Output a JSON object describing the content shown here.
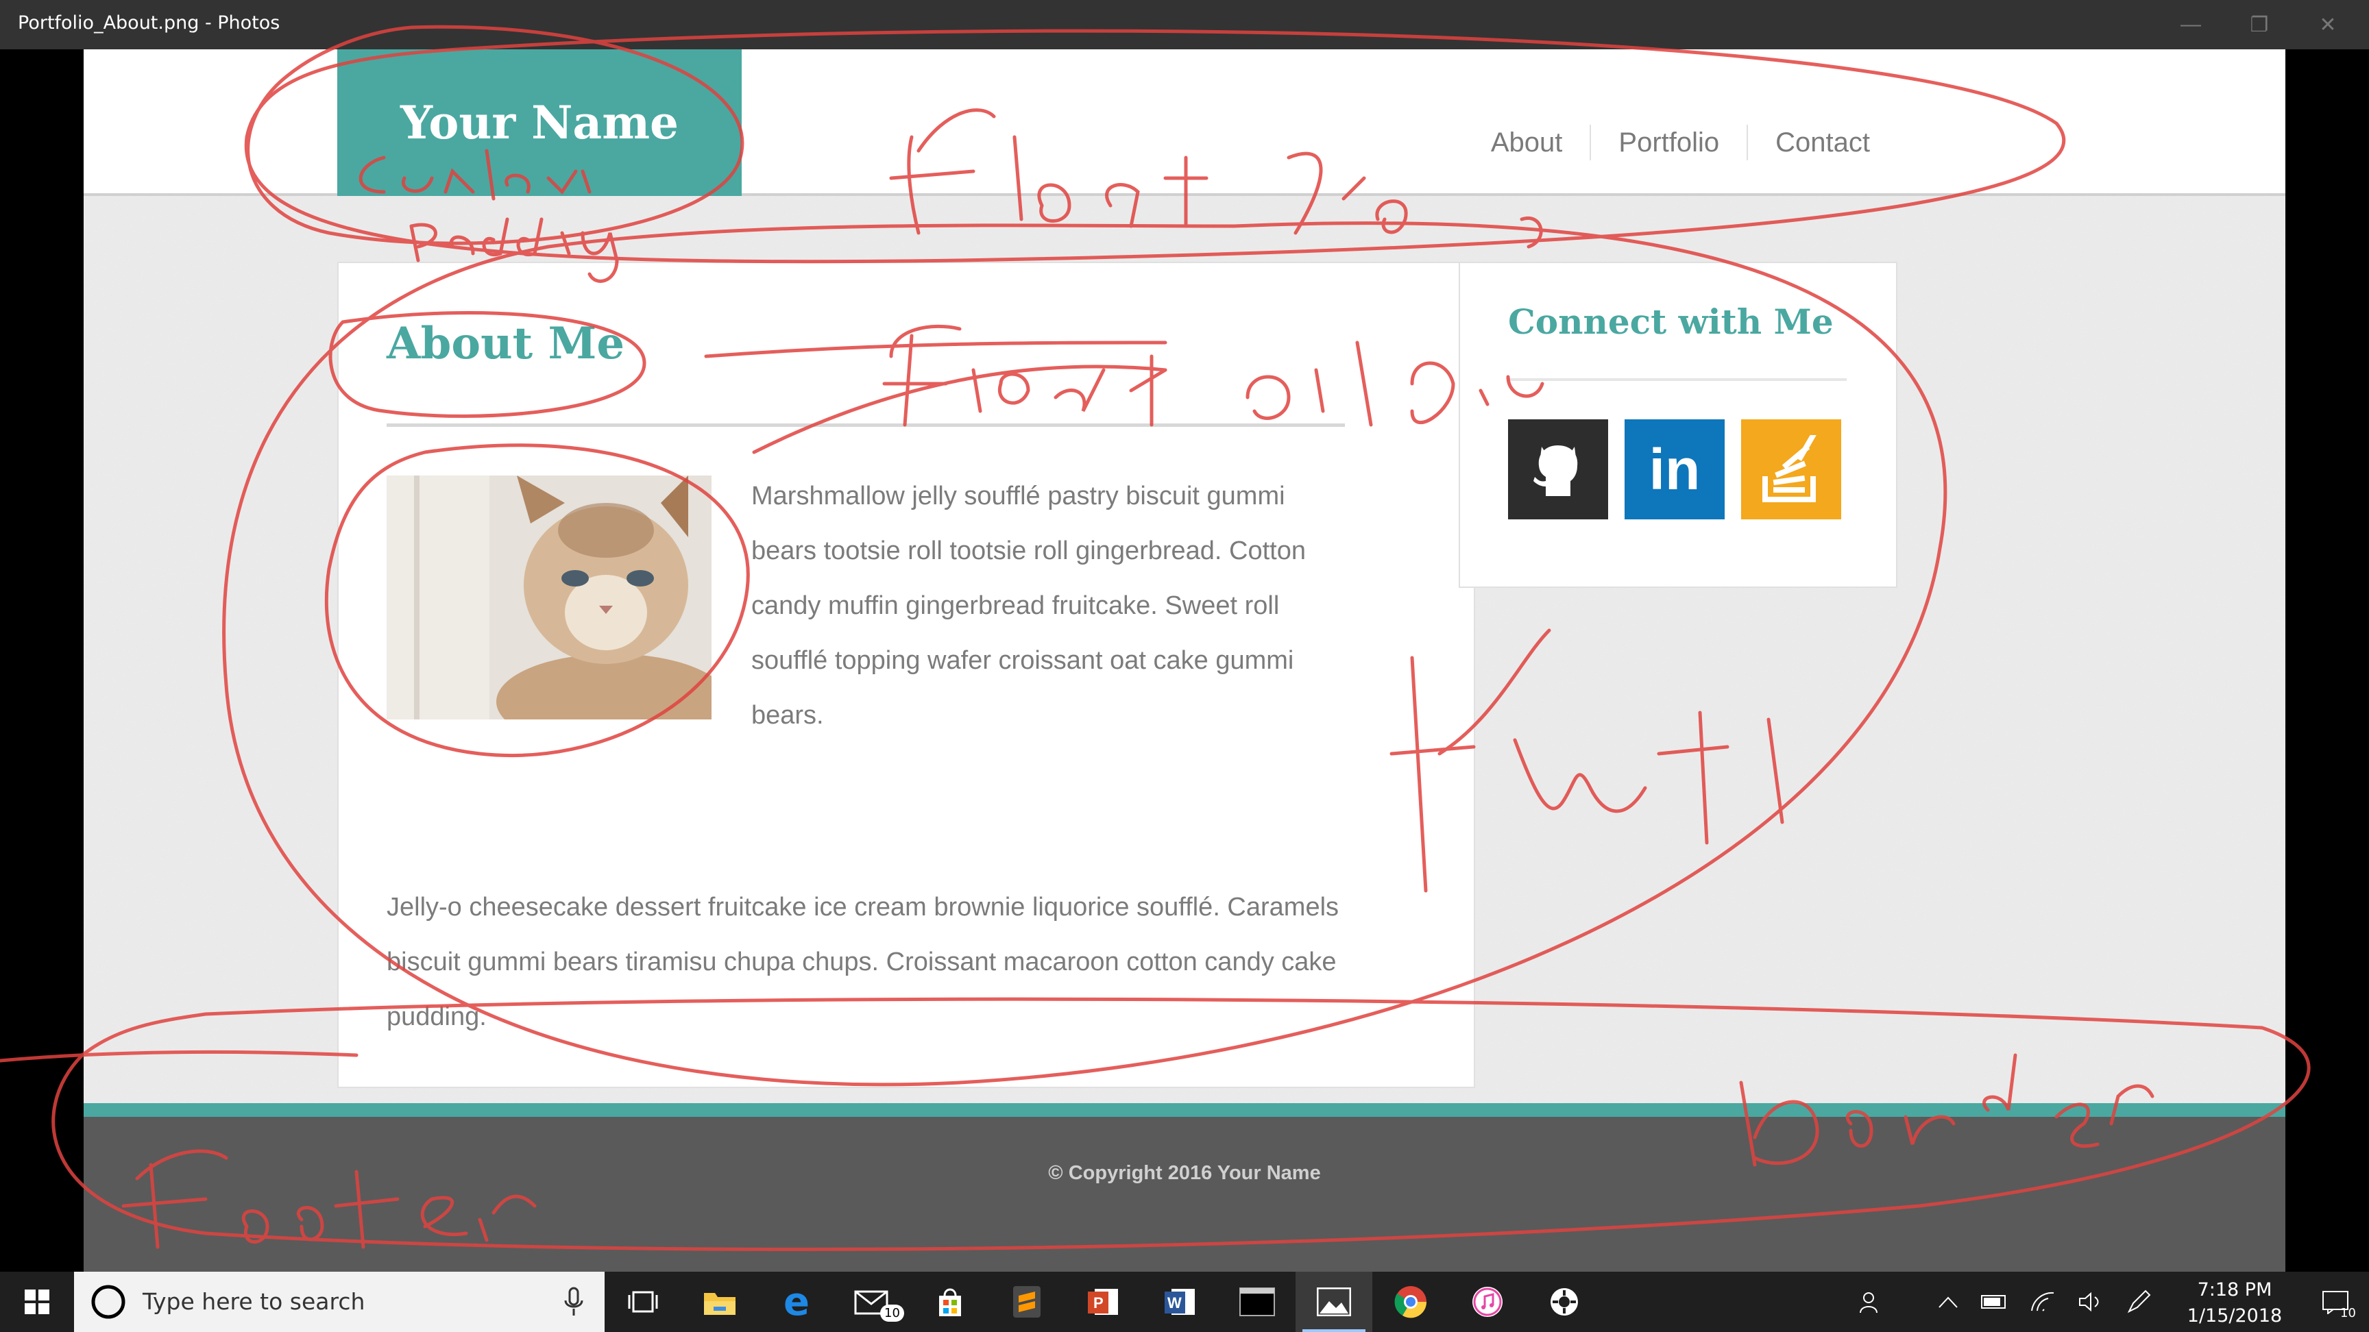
{
  "window": {
    "title": "Portfolio_About.png - Photos",
    "controls": [
      "minimize-icon",
      "restore-icon",
      "close-icon"
    ]
  },
  "site": {
    "logo_text": "Your Name",
    "nav": [
      "About",
      "Portfolio",
      "Contact"
    ],
    "about": {
      "heading": "About Me",
      "image": "cat-photo",
      "paragraph1": "Marshmallow jelly soufflé pastry biscuit gummi bears tootsie roll tootsie roll gingerbread. Cotton candy muffin gingerbread fruitcake. Sweet roll soufflé topping wafer croissant oat cake gummi bears.",
      "paragraph2": "Jelly-o cheesecake dessert fruitcake ice cream brownie liquorice soufflé. Caramels biscuit gummi bears tiramisu chupa chups. Croissant macaroon cotton candy cake pudding."
    },
    "sidebar": {
      "heading": "Connect with Me",
      "social": [
        "github-icon",
        "linkedin-icon",
        "stackoverflow-icon"
      ],
      "linkedin_text": "in"
    },
    "footer": {
      "copyright": "© Copyright 2016 Your Name"
    }
  },
  "colors": {
    "accent": "#4aa8a1",
    "annotation": "#e0433f",
    "footer_bg": "#5a5a5a"
  },
  "taskbar": {
    "search_placeholder": "Type here to search",
    "time": "7:18 PM",
    "date": "1/15/2018",
    "mail_badge": "10",
    "notification_badge": "10",
    "pinned": [
      "task-view-icon",
      "file-explorer-icon",
      "edge-icon",
      "mail-icon",
      "store-icon",
      "sublime-text-icon",
      "powerpoint-icon",
      "word-icon",
      "terminal-icon",
      "photos-icon",
      "chrome-icon",
      "itunes-icon",
      "settings-icon"
    ]
  }
}
